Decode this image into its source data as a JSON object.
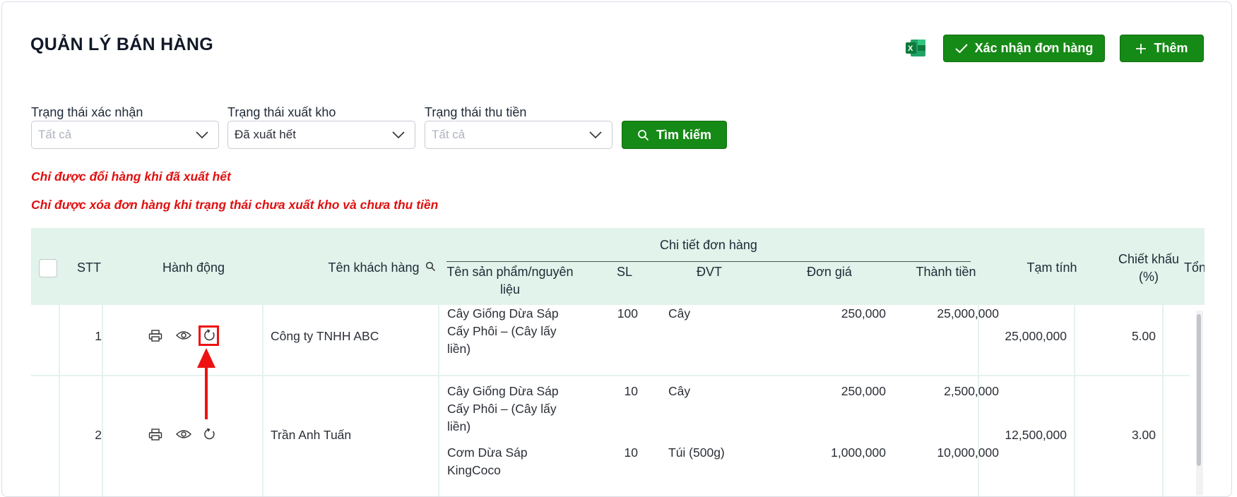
{
  "page": {
    "title": "QUẢN LÝ BÁN HÀNG"
  },
  "toolbar": {
    "excel_icon": "excel-icon",
    "confirm_label": "Xác nhận đơn hàng",
    "add_label": "Thêm",
    "colors": {
      "primary": "#168a16",
      "header_bg": "#e1f3ea",
      "warning": "#e01010"
    }
  },
  "filters": {
    "confirm_status": {
      "label": "Trạng thái xác nhận",
      "placeholder": "Tất cả",
      "value": ""
    },
    "export_status": {
      "label": "Trạng thái xuất kho",
      "placeholder": "",
      "value": "Đã xuất hết"
    },
    "payment_status": {
      "label": "Trạng thái thu tiền",
      "placeholder": "Tất cả",
      "value": ""
    },
    "search_label": "Tìm kiếm"
  },
  "warnings": {
    "exchange": "Chỉ được đổi hàng khi đã xuất hết",
    "delete": "Chỉ được xóa đơn hàng khi trạng thái chưa xuất kho và chưa thu tiền"
  },
  "table": {
    "headers": {
      "stt": "STT",
      "actions": "Hành động",
      "customer": "Tên khách hàng",
      "order_detail": "Chi tiết đơn hàng",
      "product": "Tên sản phẩm/nguyên liệu",
      "qty": "SL",
      "unit": "ĐVT",
      "price": "Đơn giá",
      "amount": "Thành tiền",
      "subtotal": "Tạm tính",
      "discount": "Chiết khấu (%)",
      "total": "Tổng"
    },
    "rows": [
      {
        "stt": "1",
        "customer": "Công ty TNHH ABC",
        "items": [
          {
            "product": "Cây Giống Dừa Sáp Cấy Phôi – (Cây lấy liền)",
            "qty": "100",
            "unit": "Cây",
            "price": "250,000",
            "amount": "25,000,000"
          }
        ],
        "subtotal": "25,000,000",
        "discount": "5.00"
      },
      {
        "stt": "2",
        "customer": "Trần Anh Tuấn",
        "items": [
          {
            "product": "Cây Giống Dừa Sáp Cấy Phôi – (Cây lấy liền)",
            "qty": "10",
            "unit": "Cây",
            "price": "250,000",
            "amount": "2,500,000"
          },
          {
            "product": "Cơm Dừa Sáp KingCoco",
            "qty": "10",
            "unit": "Túi (500g)",
            "price": "1,000,000",
            "amount": "10,000,000"
          }
        ],
        "subtotal": "12,500,000",
        "discount": "3.00"
      }
    ]
  }
}
